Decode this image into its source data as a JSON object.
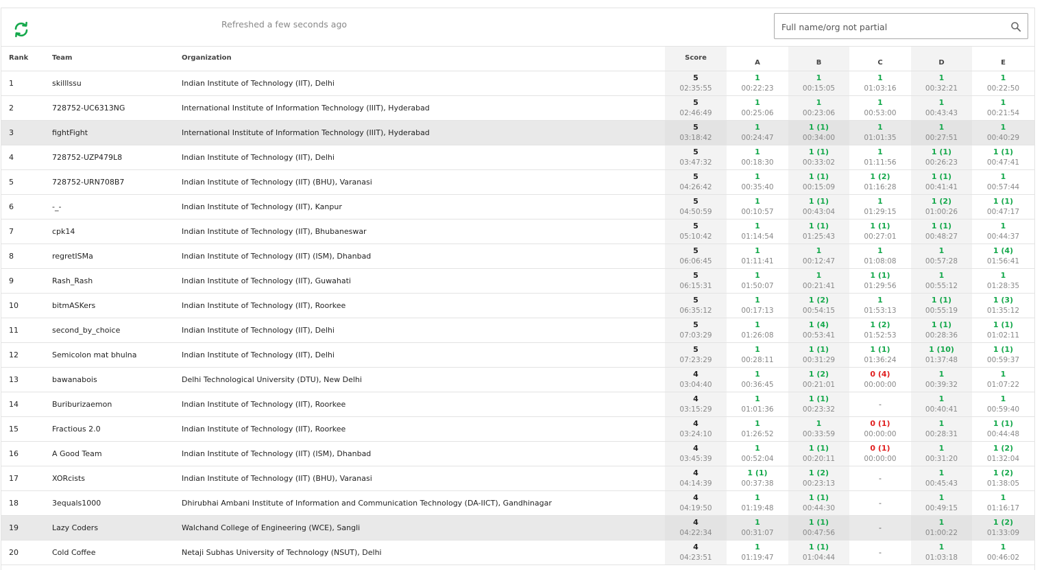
{
  "header": {
    "refresh_text": "Refreshed a few seconds ago",
    "search_placeholder": "Full name/org not partial",
    "refresh_icon": "refresh-icon",
    "search_icon": "search-icon"
  },
  "colors": {
    "accepted": "#14a84b",
    "rejected": "#e02020",
    "shaded_column": "#f3f3f3",
    "highlight_row": "#e9e9e9"
  },
  "columns": {
    "rank": "Rank",
    "team": "Team",
    "organization": "Organization",
    "score": "Score",
    "problems": [
      "A",
      "B",
      "C",
      "D",
      "E"
    ]
  },
  "rows": [
    {
      "rank": "1",
      "team": "skilllssu",
      "org": "Indian Institute of Technology (IIT), Delhi",
      "highlight": false,
      "score": "5",
      "penalty": "02:35:55",
      "problems": [
        {
          "r": "1",
          "t": "00:22:23",
          "s": "ok"
        },
        {
          "r": "1",
          "t": "00:15:05",
          "s": "ok"
        },
        {
          "r": "1",
          "t": "01:03:16",
          "s": "ok"
        },
        {
          "r": "1",
          "t": "00:32:21",
          "s": "ok"
        },
        {
          "r": "1",
          "t": "00:22:50",
          "s": "ok"
        }
      ]
    },
    {
      "rank": "2",
      "team": "728752-UC6313NG",
      "org": "International Institute of Information Technology (IIIT), Hyderabad",
      "highlight": false,
      "score": "5",
      "penalty": "02:46:49",
      "problems": [
        {
          "r": "1",
          "t": "00:25:06",
          "s": "ok"
        },
        {
          "r": "1",
          "t": "00:23:06",
          "s": "ok"
        },
        {
          "r": "1",
          "t": "00:53:00",
          "s": "ok"
        },
        {
          "r": "1",
          "t": "00:43:43",
          "s": "ok"
        },
        {
          "r": "1",
          "t": "00:21:54",
          "s": "ok"
        }
      ]
    },
    {
      "rank": "3",
      "team": "fightFight",
      "org": "International Institute of Information Technology (IIIT), Hyderabad",
      "highlight": true,
      "score": "5",
      "penalty": "03:18:42",
      "problems": [
        {
          "r": "1",
          "t": "00:24:47",
          "s": "ok"
        },
        {
          "r": "1 (1)",
          "t": "00:34:00",
          "s": "ok"
        },
        {
          "r": "1",
          "t": "01:01:35",
          "s": "ok"
        },
        {
          "r": "1",
          "t": "00:27:51",
          "s": "ok"
        },
        {
          "r": "1",
          "t": "00:40:29",
          "s": "ok"
        }
      ]
    },
    {
      "rank": "4",
      "team": "728752-UZP479L8",
      "org": "Indian Institute of Technology (IIT), Delhi",
      "highlight": false,
      "score": "5",
      "penalty": "03:47:32",
      "problems": [
        {
          "r": "1",
          "t": "00:18:30",
          "s": "ok"
        },
        {
          "r": "1 (1)",
          "t": "00:33:02",
          "s": "ok"
        },
        {
          "r": "1",
          "t": "01:11:56",
          "s": "ok"
        },
        {
          "r": "1 (1)",
          "t": "00:26:23",
          "s": "ok"
        },
        {
          "r": "1 (1)",
          "t": "00:47:41",
          "s": "ok"
        }
      ]
    },
    {
      "rank": "5",
      "team": "728752-URN708B7",
      "org": "Indian Institute of Technology (IIT) (BHU), Varanasi",
      "highlight": false,
      "score": "5",
      "penalty": "04:26:42",
      "problems": [
        {
          "r": "1",
          "t": "00:35:40",
          "s": "ok"
        },
        {
          "r": "1 (1)",
          "t": "00:15:09",
          "s": "ok"
        },
        {
          "r": "1 (2)",
          "t": "01:16:28",
          "s": "ok"
        },
        {
          "r": "1 (1)",
          "t": "00:41:41",
          "s": "ok"
        },
        {
          "r": "1",
          "t": "00:57:44",
          "s": "ok"
        }
      ]
    },
    {
      "rank": "6",
      "team": "-_-",
      "org": "Indian Institute of Technology (IIT), Kanpur",
      "highlight": false,
      "score": "5",
      "penalty": "04:50:59",
      "problems": [
        {
          "r": "1",
          "t": "00:10:57",
          "s": "ok"
        },
        {
          "r": "1 (1)",
          "t": "00:43:04",
          "s": "ok"
        },
        {
          "r": "1",
          "t": "01:29:15",
          "s": "ok"
        },
        {
          "r": "1 (2)",
          "t": "01:00:26",
          "s": "ok"
        },
        {
          "r": "1 (1)",
          "t": "00:47:17",
          "s": "ok"
        }
      ]
    },
    {
      "rank": "7",
      "team": "cpk14",
      "org": "Indian Institute of Technology (IIT), Bhubaneswar",
      "highlight": false,
      "score": "5",
      "penalty": "05:10:42",
      "problems": [
        {
          "r": "1",
          "t": "01:14:54",
          "s": "ok"
        },
        {
          "r": "1 (1)",
          "t": "01:25:43",
          "s": "ok"
        },
        {
          "r": "1 (1)",
          "t": "00:27:01",
          "s": "ok"
        },
        {
          "r": "1 (1)",
          "t": "00:48:27",
          "s": "ok"
        },
        {
          "r": "1",
          "t": "00:44:37",
          "s": "ok"
        }
      ]
    },
    {
      "rank": "8",
      "team": "regretISMa",
      "org": "Indian Institute of Technology (IIT) (ISM), Dhanbad",
      "highlight": false,
      "score": "5",
      "penalty": "06:06:45",
      "problems": [
        {
          "r": "1",
          "t": "01:11:41",
          "s": "ok"
        },
        {
          "r": "1",
          "t": "00:12:47",
          "s": "ok"
        },
        {
          "r": "1",
          "t": "01:08:08",
          "s": "ok"
        },
        {
          "r": "1",
          "t": "00:57:28",
          "s": "ok"
        },
        {
          "r": "1 (4)",
          "t": "01:56:41",
          "s": "ok"
        }
      ]
    },
    {
      "rank": "9",
      "team": "Rash_Rash",
      "org": "Indian Institute of Technology (IIT), Guwahati",
      "highlight": false,
      "score": "5",
      "penalty": "06:15:31",
      "problems": [
        {
          "r": "1",
          "t": "01:50:07",
          "s": "ok"
        },
        {
          "r": "1",
          "t": "00:21:41",
          "s": "ok"
        },
        {
          "r": "1 (1)",
          "t": "01:29:56",
          "s": "ok"
        },
        {
          "r": "1",
          "t": "00:55:12",
          "s": "ok"
        },
        {
          "r": "1",
          "t": "01:28:35",
          "s": "ok"
        }
      ]
    },
    {
      "rank": "10",
      "team": "bitmASKers",
      "org": "Indian Institute of Technology (IIT), Roorkee",
      "highlight": false,
      "score": "5",
      "penalty": "06:35:12",
      "problems": [
        {
          "r": "1",
          "t": "00:17:13",
          "s": "ok"
        },
        {
          "r": "1 (2)",
          "t": "00:54:15",
          "s": "ok"
        },
        {
          "r": "1",
          "t": "01:53:13",
          "s": "ok"
        },
        {
          "r": "1 (1)",
          "t": "00:55:19",
          "s": "ok"
        },
        {
          "r": "1 (3)",
          "t": "01:35:12",
          "s": "ok"
        }
      ]
    },
    {
      "rank": "11",
      "team": "second_by_choice",
      "org": "Indian Institute of Technology (IIT), Delhi",
      "highlight": false,
      "score": "5",
      "penalty": "07:03:29",
      "problems": [
        {
          "r": "1",
          "t": "01:26:08",
          "s": "ok"
        },
        {
          "r": "1 (4)",
          "t": "00:53:41",
          "s": "ok"
        },
        {
          "r": "1 (2)",
          "t": "01:52:53",
          "s": "ok"
        },
        {
          "r": "1 (1)",
          "t": "00:28:36",
          "s": "ok"
        },
        {
          "r": "1 (1)",
          "t": "01:02:11",
          "s": "ok"
        }
      ]
    },
    {
      "rank": "12",
      "team": "Semicolon mat bhulna",
      "org": "Indian Institute of Technology (IIT), Delhi",
      "highlight": false,
      "score": "5",
      "penalty": "07:23:29",
      "problems": [
        {
          "r": "1",
          "t": "00:28:11",
          "s": "ok"
        },
        {
          "r": "1 (1)",
          "t": "00:31:29",
          "s": "ok"
        },
        {
          "r": "1 (1)",
          "t": "01:36:24",
          "s": "ok"
        },
        {
          "r": "1 (10)",
          "t": "01:37:48",
          "s": "ok"
        },
        {
          "r": "1 (1)",
          "t": "00:59:37",
          "s": "ok"
        }
      ]
    },
    {
      "rank": "13",
      "team": "bawanabois",
      "org": "Delhi Technological University (DTU), New Delhi",
      "highlight": false,
      "score": "4",
      "penalty": "03:04:40",
      "problems": [
        {
          "r": "1",
          "t": "00:36:45",
          "s": "ok"
        },
        {
          "r": "1 (2)",
          "t": "00:21:01",
          "s": "ok"
        },
        {
          "r": "0 (4)",
          "t": "00:00:00",
          "s": "bad"
        },
        {
          "r": "1",
          "t": "00:39:32",
          "s": "ok"
        },
        {
          "r": "1",
          "t": "01:07:22",
          "s": "ok"
        }
      ]
    },
    {
      "rank": "14",
      "team": "Buriburizaemon",
      "org": "Indian Institute of Technology (IIT), Roorkee",
      "highlight": false,
      "score": "4",
      "penalty": "03:15:29",
      "problems": [
        {
          "r": "1",
          "t": "01:01:36",
          "s": "ok"
        },
        {
          "r": "1 (1)",
          "t": "00:23:32",
          "s": "ok"
        },
        {
          "r": "-",
          "t": "",
          "s": "none"
        },
        {
          "r": "1",
          "t": "00:40:41",
          "s": "ok"
        },
        {
          "r": "1",
          "t": "00:59:40",
          "s": "ok"
        }
      ]
    },
    {
      "rank": "15",
      "team": "Fractious 2.0",
      "org": "Indian Institute of Technology (IIT), Roorkee",
      "highlight": false,
      "score": "4",
      "penalty": "03:24:10",
      "problems": [
        {
          "r": "1",
          "t": "01:26:52",
          "s": "ok"
        },
        {
          "r": "1",
          "t": "00:33:59",
          "s": "ok"
        },
        {
          "r": "0 (1)",
          "t": "00:00:00",
          "s": "bad"
        },
        {
          "r": "1",
          "t": "00:28:31",
          "s": "ok"
        },
        {
          "r": "1 (1)",
          "t": "00:44:48",
          "s": "ok"
        }
      ]
    },
    {
      "rank": "16",
      "team": "A Good Team",
      "org": "Indian Institute of Technology (IIT) (ISM), Dhanbad",
      "highlight": false,
      "score": "4",
      "penalty": "03:45:39",
      "problems": [
        {
          "r": "1",
          "t": "00:52:04",
          "s": "ok"
        },
        {
          "r": "1 (1)",
          "t": "00:20:11",
          "s": "ok"
        },
        {
          "r": "0 (1)",
          "t": "00:00:00",
          "s": "bad"
        },
        {
          "r": "1",
          "t": "00:31:20",
          "s": "ok"
        },
        {
          "r": "1 (2)",
          "t": "01:32:04",
          "s": "ok"
        }
      ]
    },
    {
      "rank": "17",
      "team": "XORcists",
      "org": "Indian Institute of Technology (IIT) (BHU), Varanasi",
      "highlight": false,
      "score": "4",
      "penalty": "04:14:39",
      "problems": [
        {
          "r": "1 (1)",
          "t": "00:37:38",
          "s": "ok"
        },
        {
          "r": "1 (2)",
          "t": "00:23:13",
          "s": "ok"
        },
        {
          "r": "-",
          "t": "",
          "s": "none"
        },
        {
          "r": "1",
          "t": "00:45:43",
          "s": "ok"
        },
        {
          "r": "1 (2)",
          "t": "01:38:05",
          "s": "ok"
        }
      ]
    },
    {
      "rank": "18",
      "team": "3equals1000",
      "org": "Dhirubhai Ambani Institute of Information and Communication Technology (DA-IICT), Gandhinagar",
      "highlight": false,
      "score": "4",
      "penalty": "04:19:50",
      "problems": [
        {
          "r": "1",
          "t": "01:19:48",
          "s": "ok"
        },
        {
          "r": "1 (1)",
          "t": "00:44:30",
          "s": "ok"
        },
        {
          "r": "-",
          "t": "",
          "s": "none"
        },
        {
          "r": "1",
          "t": "00:49:15",
          "s": "ok"
        },
        {
          "r": "1",
          "t": "01:16:17",
          "s": "ok"
        }
      ]
    },
    {
      "rank": "19",
      "team": "Lazy Coders",
      "org": "Walchand College of Engineering (WCE), Sangli",
      "highlight": true,
      "score": "4",
      "penalty": "04:22:34",
      "problems": [
        {
          "r": "1",
          "t": "00:31:07",
          "s": "ok"
        },
        {
          "r": "1 (1)",
          "t": "00:47:56",
          "s": "ok"
        },
        {
          "r": "-",
          "t": "",
          "s": "none"
        },
        {
          "r": "1",
          "t": "01:00:22",
          "s": "ok"
        },
        {
          "r": "1 (2)",
          "t": "01:33:09",
          "s": "ok"
        }
      ]
    },
    {
      "rank": "20",
      "team": "Cold Coffee",
      "org": "Netaji Subhas University of Technology (NSUT), Delhi",
      "highlight": false,
      "score": "4",
      "penalty": "04:23:51",
      "problems": [
        {
          "r": "1",
          "t": "01:19:47",
          "s": "ok"
        },
        {
          "r": "1 (1)",
          "t": "01:04:44",
          "s": "ok"
        },
        {
          "r": "-",
          "t": "",
          "s": "none"
        },
        {
          "r": "1",
          "t": "01:03:18",
          "s": "ok"
        },
        {
          "r": "1",
          "t": "00:46:02",
          "s": "ok"
        }
      ]
    }
  ]
}
